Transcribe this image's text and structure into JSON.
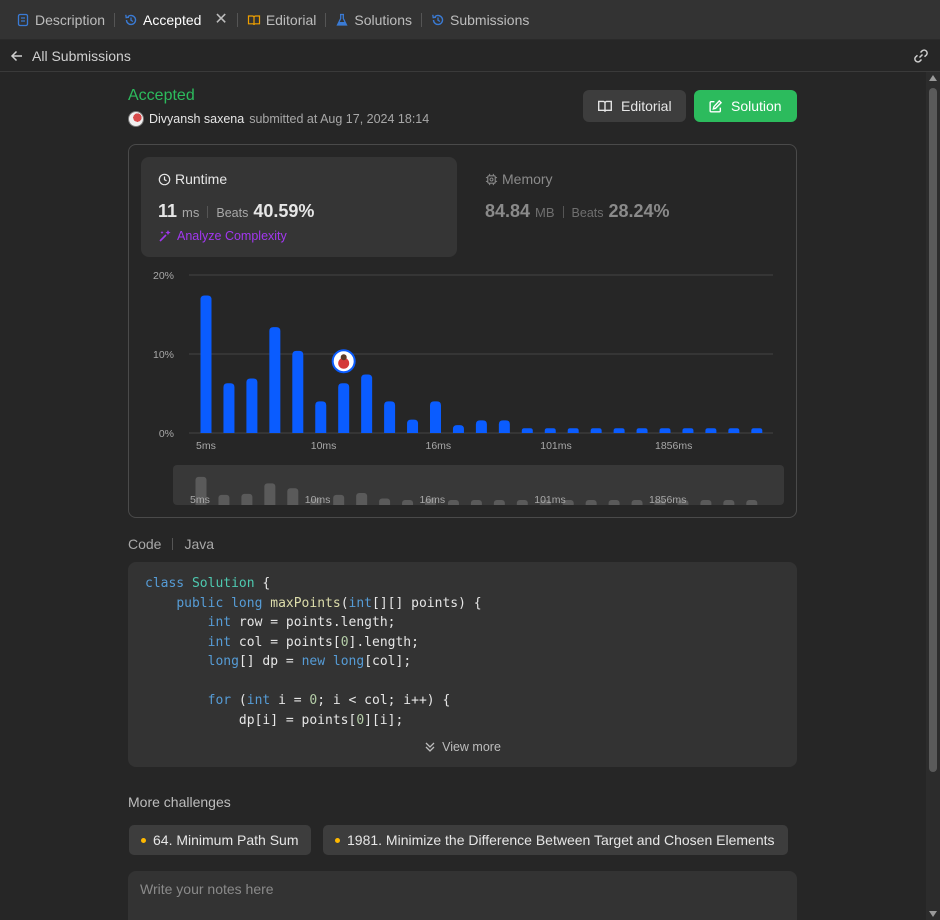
{
  "tabs": [
    {
      "label": "Description",
      "icon": "description-icon",
      "color": "#3a7bd5",
      "active": false
    },
    {
      "label": "Accepted",
      "icon": "history-icon",
      "color": "#3a7bd5",
      "active": true
    },
    {
      "label": "Editorial",
      "icon": "book-icon",
      "color": "#f0a000",
      "active": false
    },
    {
      "label": "Solutions",
      "icon": "flask-icon",
      "color": "#3a7bd5",
      "active": false
    },
    {
      "label": "Submissions",
      "icon": "history-icon",
      "color": "#3a7bd5",
      "active": false
    }
  ],
  "subheader": {
    "back_label": "All Submissions"
  },
  "submission": {
    "status": "Accepted",
    "user": "Divyansh saxena",
    "submitted_text": "submitted at Aug 17, 2024 18:14",
    "editorial_label": "Editorial",
    "solution_label": "Solution"
  },
  "runtime": {
    "title": "Runtime",
    "value": "11",
    "unit": "ms",
    "beats_label": "Beats",
    "beats": "40.59%",
    "analyze_label": "Analyze Complexity"
  },
  "memory": {
    "title": "Memory",
    "value": "84.84",
    "unit": "MB",
    "beats_label": "Beats",
    "beats": "28.24%"
  },
  "chart_data": {
    "type": "bar",
    "x_ticks": [
      "5ms",
      "10ms",
      "16ms",
      "101ms",
      "1856ms"
    ],
    "y_ticks": [
      "20%",
      "10%",
      "0%"
    ],
    "ylim": [
      0,
      20
    ],
    "values": [
      17.4,
      6.3,
      6.9,
      13.4,
      10.4,
      4.0,
      6.3,
      7.4,
      4.0,
      1.7,
      4.0,
      1.0,
      1.6,
      1.6,
      0.6,
      0.6,
      0.6,
      0.6,
      0.6,
      0.6,
      0.6,
      0.6,
      0.6,
      0.6,
      0.6
    ],
    "highlight_index": 6,
    "bar_color": "#0a5cff",
    "grid": true
  },
  "code": {
    "label": "Code",
    "language": "Java",
    "view_more": "View more"
  },
  "more": {
    "title": "More challenges",
    "items": [
      "64. Minimum Path Sum",
      "1981. Minimize the Difference Between Target and Chosen Elements"
    ]
  },
  "notes": {
    "placeholder": "Write your notes here"
  }
}
